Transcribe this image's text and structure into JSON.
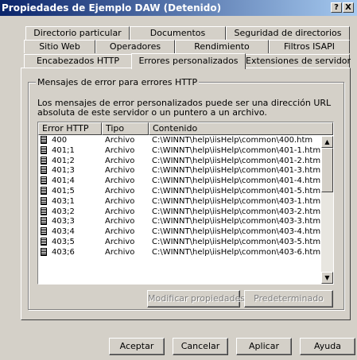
{
  "window": {
    "title": "Propiedades de Ejemplo DAW (Detenido)",
    "help_button": "?",
    "close_button": "X"
  },
  "tabs": {
    "row1": [
      "Directorio particular",
      "Documentos",
      "Seguridad de directorios"
    ],
    "row2": [
      "Sitio Web",
      "Operadores",
      "Rendimiento",
      "Filtros ISAPI"
    ],
    "row3_left": "Encabezados HTTP",
    "row3_active": "Errores personalizados",
    "row3_right": "Extensiones de servidor"
  },
  "group": {
    "legend": "Mensajes de error para errores HTTP",
    "description": "Los mensajes de error personalizados puede ser una dirección URL absoluta de este servidor o un puntero a un archivo."
  },
  "list": {
    "columns": [
      "Error HTTP",
      "Tipo",
      "Contenido"
    ],
    "rows": [
      {
        "code": "400",
        "type": "Archivo",
        "content": "C:\\WINNT\\help\\iisHelp\\common\\400.htm"
      },
      {
        "code": "401;1",
        "type": "Archivo",
        "content": "C:\\WINNT\\help\\iisHelp\\common\\401-1.htm"
      },
      {
        "code": "401;2",
        "type": "Archivo",
        "content": "C:\\WINNT\\help\\iisHelp\\common\\401-2.htm"
      },
      {
        "code": "401;3",
        "type": "Archivo",
        "content": "C:\\WINNT\\help\\iisHelp\\common\\401-3.htm"
      },
      {
        "code": "401;4",
        "type": "Archivo",
        "content": "C:\\WINNT\\help\\iisHelp\\common\\401-4.htm"
      },
      {
        "code": "401;5",
        "type": "Archivo",
        "content": "C:\\WINNT\\help\\iisHelp\\common\\401-5.htm"
      },
      {
        "code": "403;1",
        "type": "Archivo",
        "content": "C:\\WINNT\\help\\iisHelp\\common\\403-1.htm"
      },
      {
        "code": "403;2",
        "type": "Archivo",
        "content": "C:\\WINNT\\help\\iisHelp\\common\\403-2.htm"
      },
      {
        "code": "403;3",
        "type": "Archivo",
        "content": "C:\\WINNT\\help\\iisHelp\\common\\403-3.htm"
      },
      {
        "code": "403;4",
        "type": "Archivo",
        "content": "C:\\WINNT\\help\\iisHelp\\common\\403-4.htm"
      },
      {
        "code": "403;5",
        "type": "Archivo",
        "content": "C:\\WINNT\\help\\iisHelp\\common\\403-5.htm"
      },
      {
        "code": "403;6",
        "type": "Archivo",
        "content": "C:\\WINNT\\help\\iisHelp\\common\\403-6.htm"
      }
    ]
  },
  "buttons": {
    "modify": "Modificar propiedades...",
    "default": "Predeterminado",
    "ok": "Aceptar",
    "cancel": "Cancelar",
    "apply": "Aplicar",
    "help": "Ayuda"
  },
  "colors": {
    "title_start": "#0a246a",
    "title_end": "#a6caf0",
    "face": "#d4d0c8"
  }
}
